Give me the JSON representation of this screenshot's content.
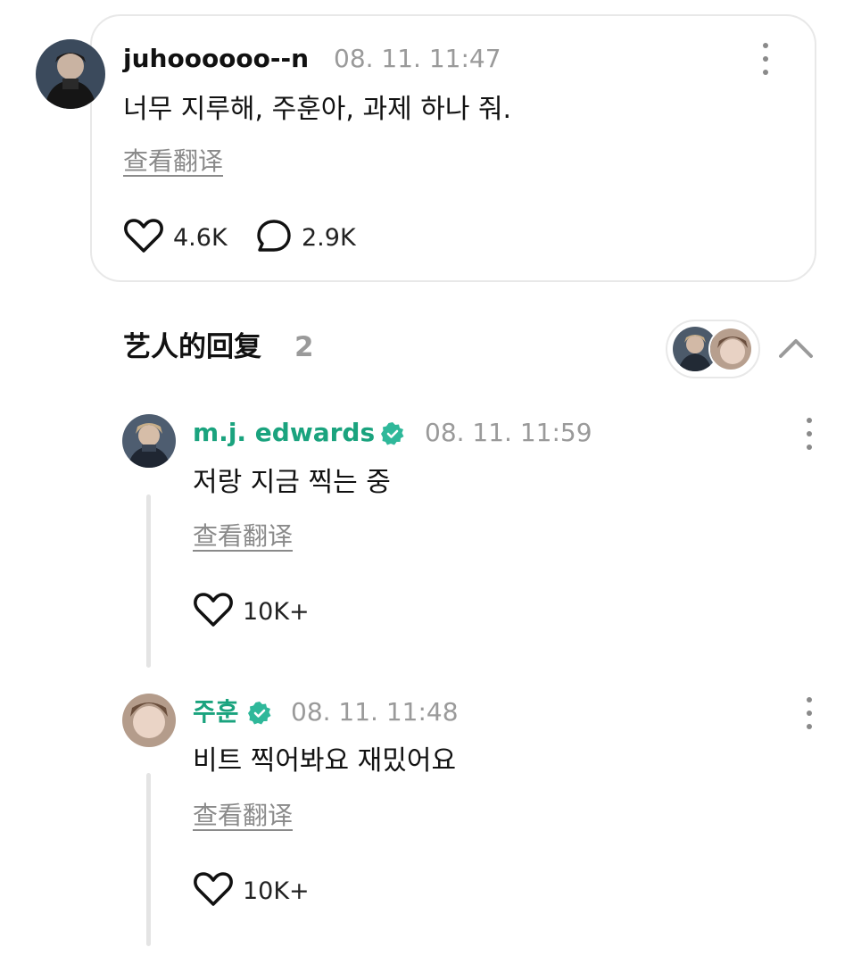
{
  "post": {
    "username": "juhoooooo--n",
    "timestamp": "08. 11. 11:47",
    "text": "너무 지루해, 주훈아, 과제 하나 줘.",
    "translate_label": "查看翻译",
    "likes": "4.6K",
    "comments": "2.9K"
  },
  "artist_replies": {
    "title": "艺人的回复",
    "count": "2"
  },
  "replies": [
    {
      "username": "m.j. edwards",
      "timestamp": "08. 11. 11:59",
      "text": "저랑 지금 찍는 중",
      "translate_label": "查看翻译",
      "likes": "10K+"
    },
    {
      "username": "주훈",
      "timestamp": "08. 11. 11:48",
      "text": "비트 찍어봐요 재밌어요",
      "translate_label": "查看翻译",
      "likes": "10K+"
    }
  ],
  "colors": {
    "artist_name": "#1aa37e",
    "verified_badge": "#2fb89a",
    "muted_text": "#9a9a9a"
  },
  "icons": {
    "like": "heart-outline-icon",
    "comment": "speech-bubble-icon",
    "more": "more-vertical-icon",
    "verified": "verified-badge-icon",
    "collapse": "chevron-up-icon"
  }
}
